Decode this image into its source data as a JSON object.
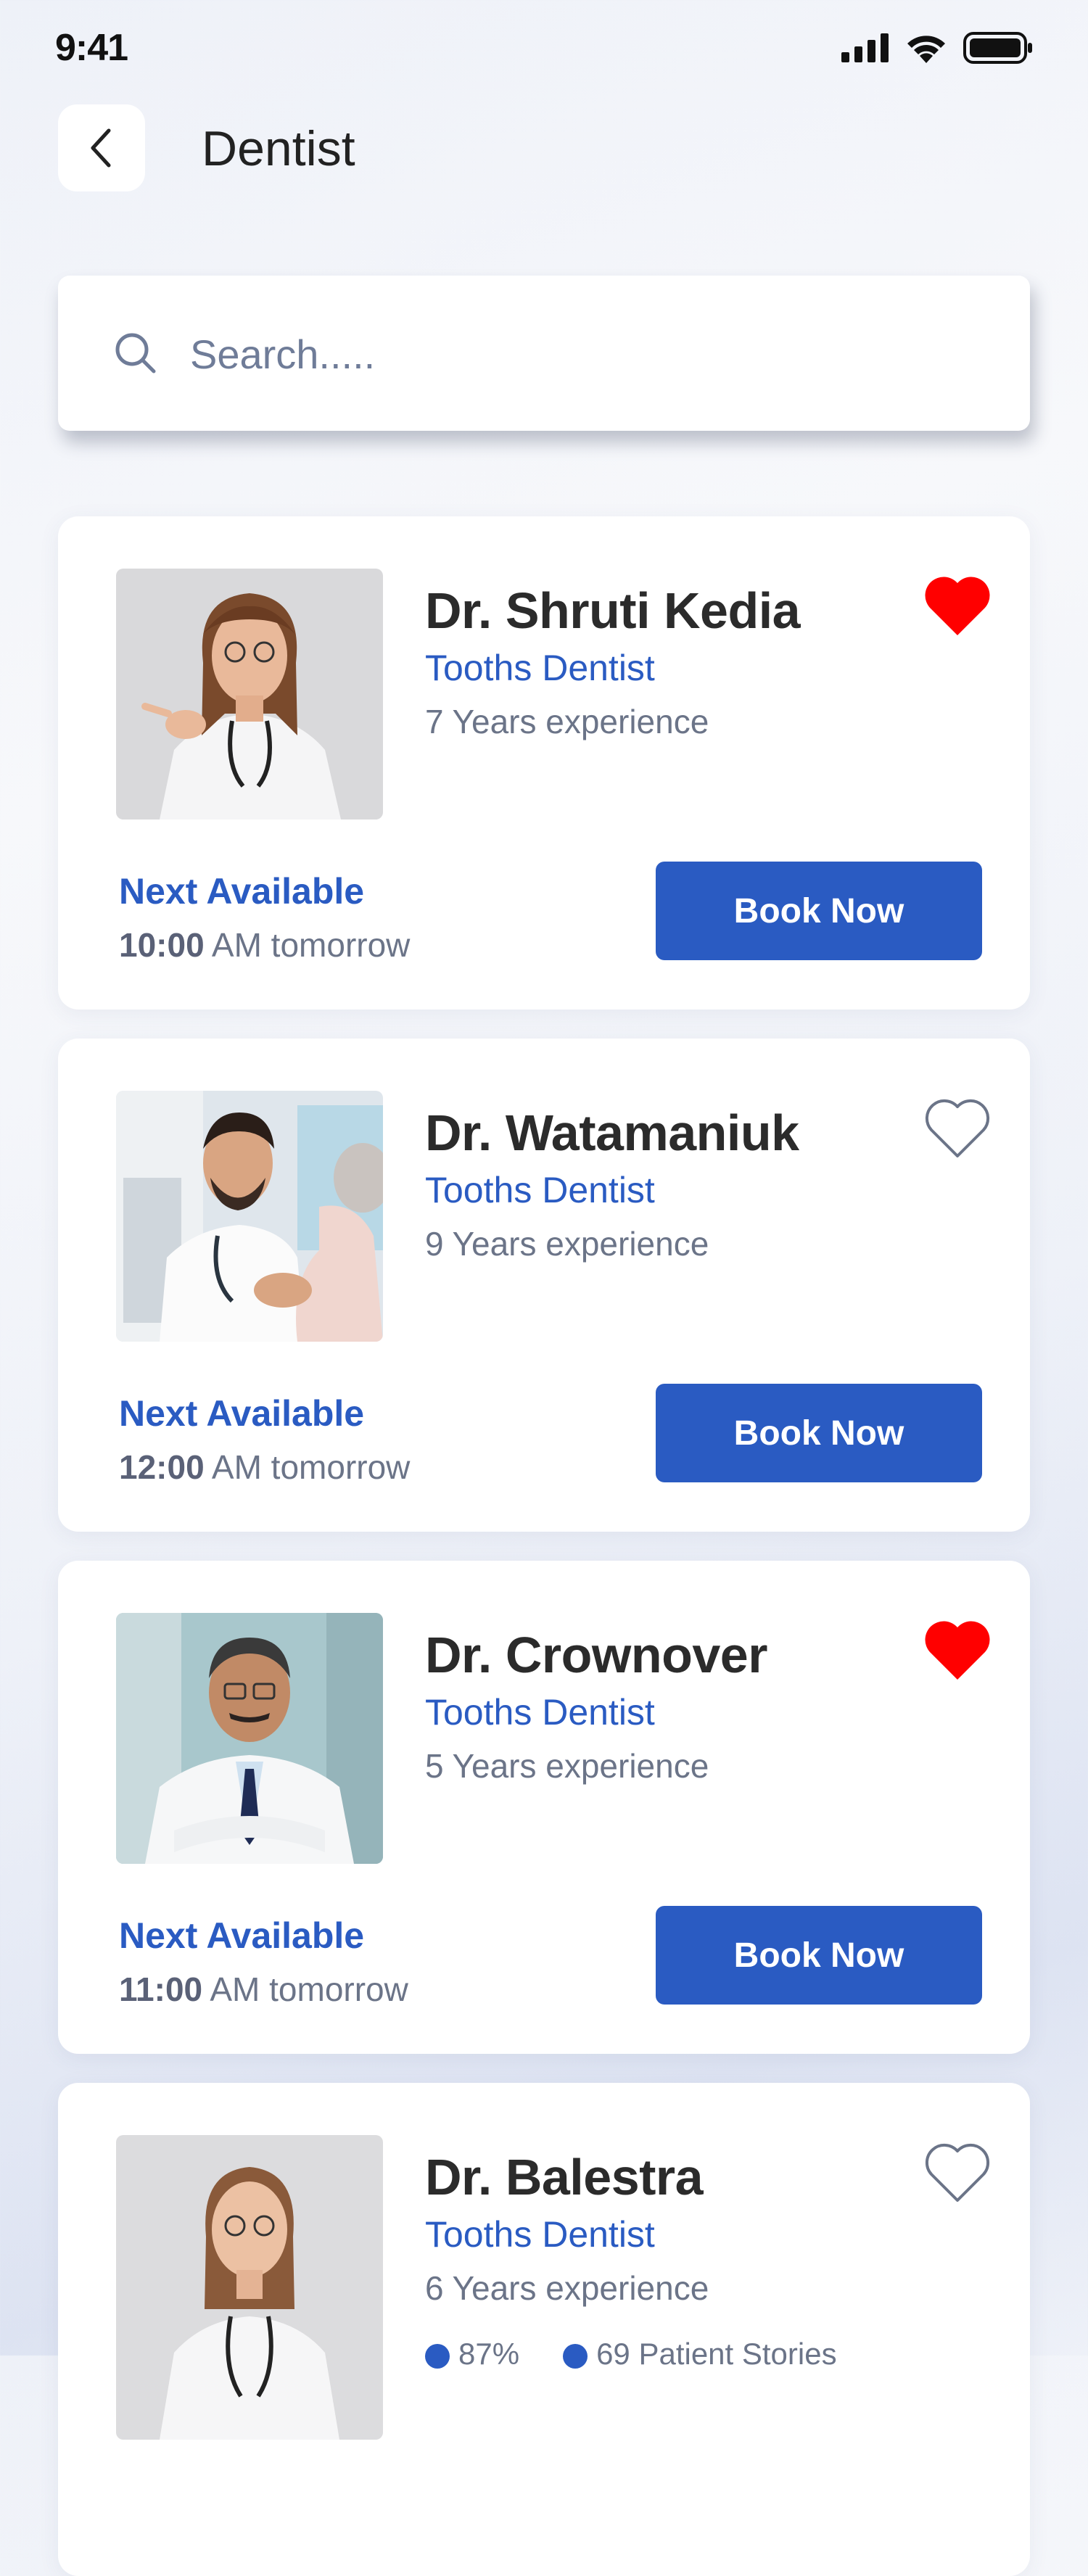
{
  "status_bar": {
    "time": "9:41"
  },
  "header": {
    "title": "Dentist"
  },
  "search": {
    "placeholder": "Search....."
  },
  "colors": {
    "accent": "#2a5bc2",
    "favorite": "#ff0000",
    "muted": "#6b7488"
  },
  "doctors": [
    {
      "name": "Dr. Shruti Kedia",
      "specialty": "Tooths Dentist",
      "experience": "7 Years experience",
      "favorite": true,
      "next_label": "Next Available",
      "next_time": "10:00",
      "next_suffix": " AM tomorrow",
      "button": "Book Now"
    },
    {
      "name": "Dr. Watamaniuk",
      "specialty": "Tooths Dentist",
      "experience": "9 Years experience",
      "favorite": false,
      "next_label": "Next Available",
      "next_time": "12:00",
      "next_suffix": " AM tomorrow",
      "button": "Book Now"
    },
    {
      "name": "Dr. Crownover",
      "specialty": "Tooths Dentist",
      "experience": "5 Years experience",
      "favorite": true,
      "next_label": "Next Available",
      "next_time": "11:00",
      "next_suffix": " AM tomorrow",
      "button": "Book Now"
    },
    {
      "name": "Dr. Balestra",
      "specialty": "Tooths Dentist",
      "experience": "6 Years experience",
      "favorite": false,
      "rating": "87%",
      "stories": "69 Patient Stories"
    }
  ]
}
